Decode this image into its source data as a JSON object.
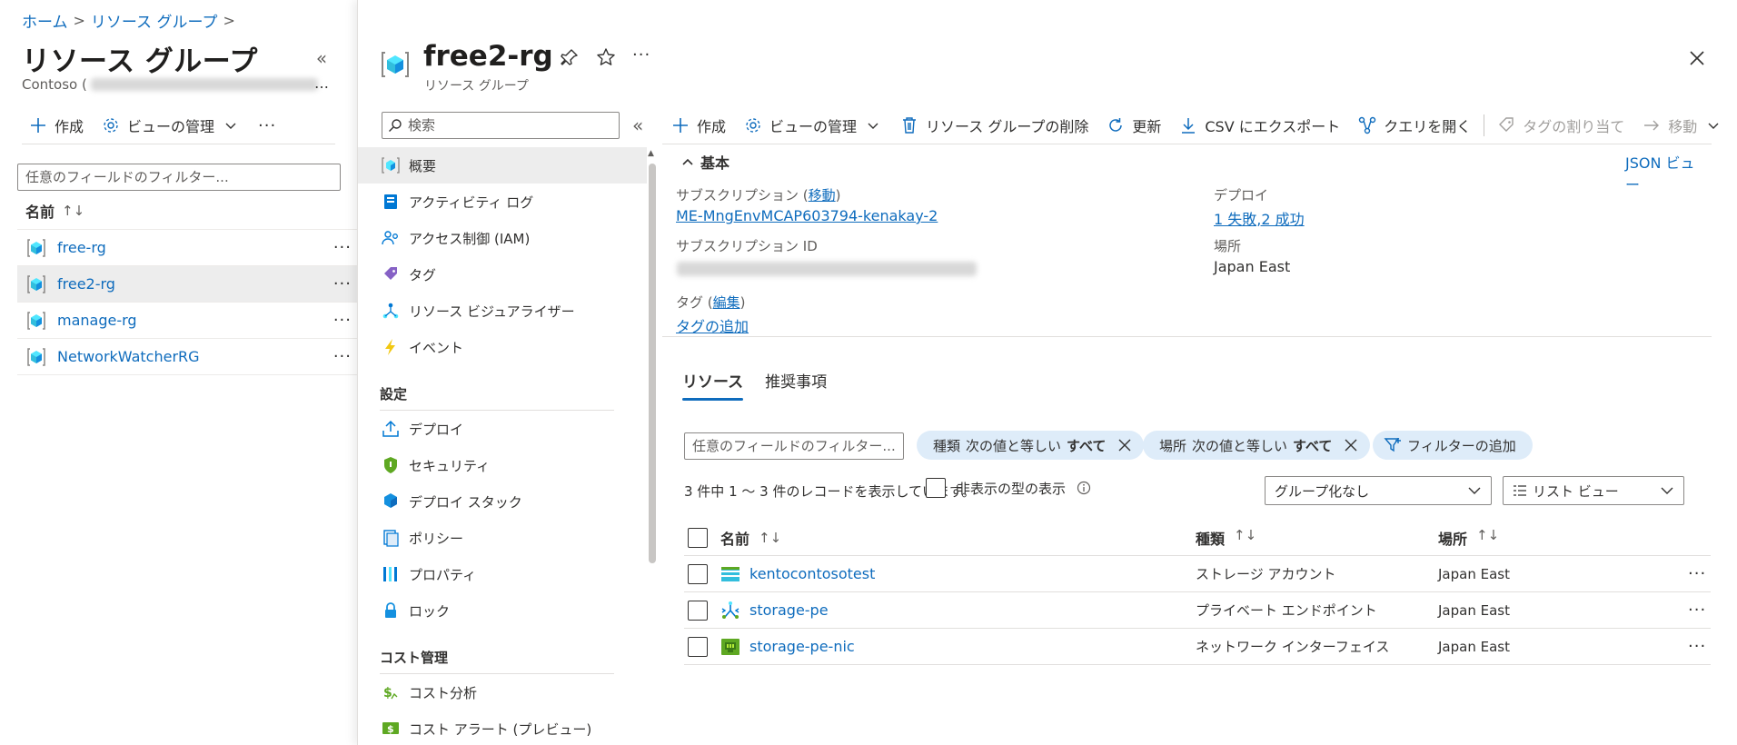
{
  "breadcrumb": {
    "items": [
      "ホーム",
      "リソース グループ"
    ],
    "sep": ">"
  },
  "left_panel": {
    "title": "リソース グループ",
    "subtitle_prefix": "Contoso (",
    "toolbar": {
      "create": "作成",
      "manage_view": "ビューの管理",
      "more": "···"
    },
    "filter_placeholder": "任意のフィールドのフィルター...",
    "column_name": "名前",
    "sort_glyph": "↑↓",
    "resource_groups": [
      {
        "name": "free-rg",
        "selected": false
      },
      {
        "name": "free2-rg",
        "selected": true
      },
      {
        "name": "manage-rg",
        "selected": false
      },
      {
        "name": "NetworkWatcherRG",
        "selected": false
      }
    ]
  },
  "blade": {
    "title": "free2-rg",
    "subtitle": "リソース グループ",
    "more": "···",
    "nav": {
      "search_placeholder": "検索",
      "items": [
        {
          "label": "概要",
          "icon": "cube-icon",
          "active": true
        },
        {
          "label": "アクティビティ ログ",
          "icon": "activity-log-icon"
        },
        {
          "label": "アクセス制御 (IAM)",
          "icon": "iam-icon"
        },
        {
          "label": "タグ",
          "icon": "tag-icon"
        },
        {
          "label": "リソース ビジュアライザー",
          "icon": "visualizer-icon"
        },
        {
          "label": "イベント",
          "icon": "lightning-icon"
        }
      ],
      "group_settings": "設定",
      "settings_items": [
        {
          "label": "デプロイ",
          "icon": "deploy-icon"
        },
        {
          "label": "セキュリティ",
          "icon": "shield-icon"
        },
        {
          "label": "デプロイ スタック",
          "icon": "stack-icon"
        },
        {
          "label": "ポリシー",
          "icon": "policy-icon"
        },
        {
          "label": "プロパティ",
          "icon": "properties-icon"
        },
        {
          "label": "ロック",
          "icon": "lock-icon"
        }
      ],
      "group_cost": "コスト管理",
      "cost_items": [
        {
          "label": "コスト分析",
          "icon": "cost-analysis-icon"
        },
        {
          "label": "コスト アラート (プレビュー)",
          "icon": "cost-alert-icon"
        }
      ]
    },
    "toolbar": {
      "create": "作成",
      "manage_view": "ビューの管理",
      "delete_rg": "リソース グループの削除",
      "refresh": "更新",
      "export_csv": "CSV にエクスポート",
      "open_query": "クエリを開く",
      "assign_tags": "タグの割り当て",
      "move": "移動",
      "more": "···"
    },
    "essentials": {
      "header": "基本",
      "json_view": "JSON ビュー",
      "subscription_label": "サブスクリプション (",
      "subscription_move": "移動",
      "subscription_label_close": ")",
      "subscription_value": "ME-MngEnvMCAP603794-kenakay-2",
      "subscription_id_label": "サブスクリプション ID",
      "deploy_label": "デプロイ",
      "deploy_value": "1 失敗,2 成功",
      "location_label": "場所",
      "location_value": "Japan East",
      "tags_label": "タグ (",
      "tags_edit": "編集",
      "tags_label_close": ")",
      "tags_add": "タグの追加"
    },
    "tabs": [
      "リソース",
      "推奨事項"
    ],
    "resources": {
      "filter_placeholder": "任意のフィールドのフィルター...",
      "pill_type": {
        "field": "種類",
        "op": "次の値と等しい",
        "value": "すべて"
      },
      "pill_location": {
        "field": "場所",
        "op": "次の値と等しい",
        "value": "すべて"
      },
      "add_filter": "フィルターの追加",
      "record_count": "3 件中 1 ～ 3 件のレコードを表示しています。",
      "show_hidden": "非表示の型の表示",
      "group_by": "グループ化なし",
      "view_mode": "リスト ビュー",
      "columns": {
        "name": "名前",
        "type": "種類",
        "location": "場所"
      },
      "rows": [
        {
          "name": "kentocontosotest",
          "type": "ストレージ アカウント",
          "location": "Japan East",
          "icon": "storage-account-icon"
        },
        {
          "name": "storage-pe",
          "type": "プライベート エンドポイント",
          "location": "Japan East",
          "icon": "private-endpoint-icon"
        },
        {
          "name": "storage-pe-nic",
          "type": "ネットワーク インターフェイス",
          "location": "Japan East",
          "icon": "network-interface-icon"
        }
      ]
    }
  },
  "colors": {
    "link": "#0f6cbd",
    "selected_row": "#ededed",
    "pill": "#deecf9",
    "accent": "#0f6cbd"
  }
}
